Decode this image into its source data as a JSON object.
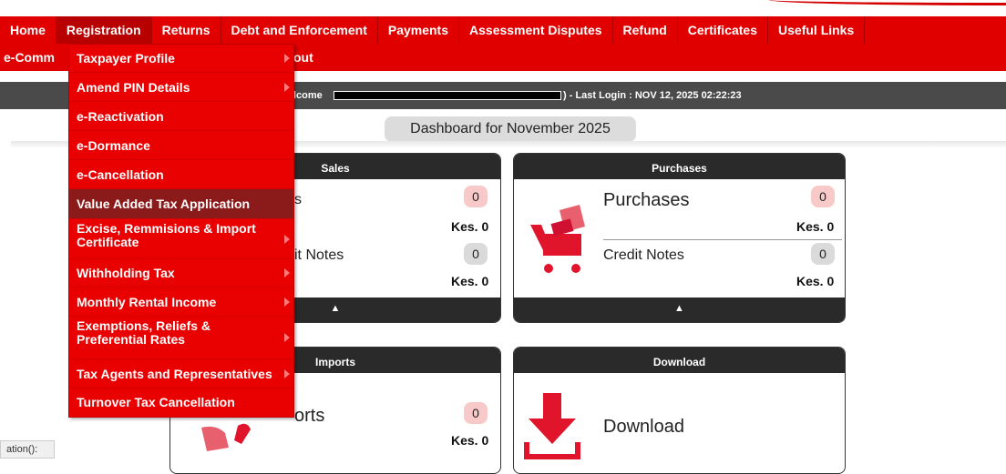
{
  "nav": {
    "row1": [
      "Home",
      "Registration",
      "Returns",
      "Debt and Enforcement",
      "Payments",
      "Assessment Disputes",
      "Refund",
      "Certificates",
      "Useful Links"
    ],
    "row2_left": "e-Comm",
    "row2_right": "out"
  },
  "bar": {
    "welcome": "lcome",
    "close_paren": ")",
    "last_login": " - Last Login : NOV 12, 2025 02:22:23"
  },
  "dashboard": {
    "title": "Dashboard for November 2025"
  },
  "sales": {
    "header": "Sales",
    "label1": "s",
    "count1": "0",
    "amount1": "Kes. 0",
    "label2": "it Notes",
    "count2": "0",
    "amount2": "Kes. 0",
    "toggle": "▲"
  },
  "purchases": {
    "header": "Purchases",
    "label1": "Purchases",
    "count1": "0",
    "amount1": "Kes. 0",
    "label2": "Credit Notes",
    "count2": "0",
    "amount2": "Kes. 0",
    "toggle": "▲"
  },
  "imports": {
    "header": "Imports",
    "label1": "orts",
    "count1": "0",
    "amount1": "Kes. 0"
  },
  "download": {
    "header": "Download",
    "label": "Download"
  },
  "menu": {
    "items": [
      {
        "label": "Taxpayer Profile",
        "sub": true
      },
      {
        "label": "Amend PIN Details",
        "sub": true
      },
      {
        "label": "e-Reactivation",
        "sub": false
      },
      {
        "label": "e-Dormance",
        "sub": false
      },
      {
        "label": "e-Cancellation",
        "sub": false
      },
      {
        "label": "Value Added Tax Application",
        "sub": false
      },
      {
        "label": "Excise, Remmisions & Import Certificate",
        "sub": true
      },
      {
        "label": "Withholding Tax",
        "sub": true
      },
      {
        "label": "Monthly Rental Income",
        "sub": true
      },
      {
        "label": "Exemptions, Reliefs & Preferential Rates",
        "sub": true
      },
      {
        "label": "Tax Agents and Representatives",
        "sub": true
      },
      {
        "label": "Turnover Tax Cancellation",
        "sub": false
      }
    ]
  },
  "status": {
    "text": "ation():"
  },
  "colors": {
    "nav_red": "#e00000",
    "menu_highlight": "#8b1a1a",
    "dark": "#2a2a2a"
  }
}
